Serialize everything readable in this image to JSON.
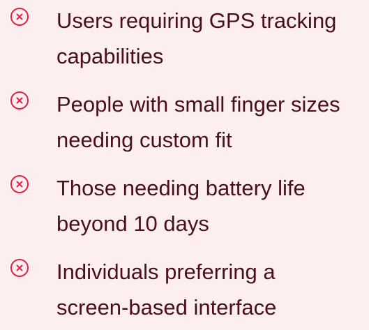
{
  "list": {
    "items": [
      {
        "line1": "Users requiring GPS tracking",
        "line2": "capabilities",
        "icon": "close-circle-icon"
      },
      {
        "line1": "People with small finger sizes",
        "line2": "needing custom fit",
        "icon": "close-circle-icon"
      },
      {
        "line1": "Those needing battery life",
        "line2": "beyond 10 days",
        "icon": "close-circle-icon"
      },
      {
        "line1": "Individuals preferring a",
        "line2": "screen-based interface",
        "icon": "close-circle-icon"
      }
    ]
  },
  "colors": {
    "background": "#fdeff0",
    "text": "#4a0f1c",
    "icon": "#e0243f"
  }
}
